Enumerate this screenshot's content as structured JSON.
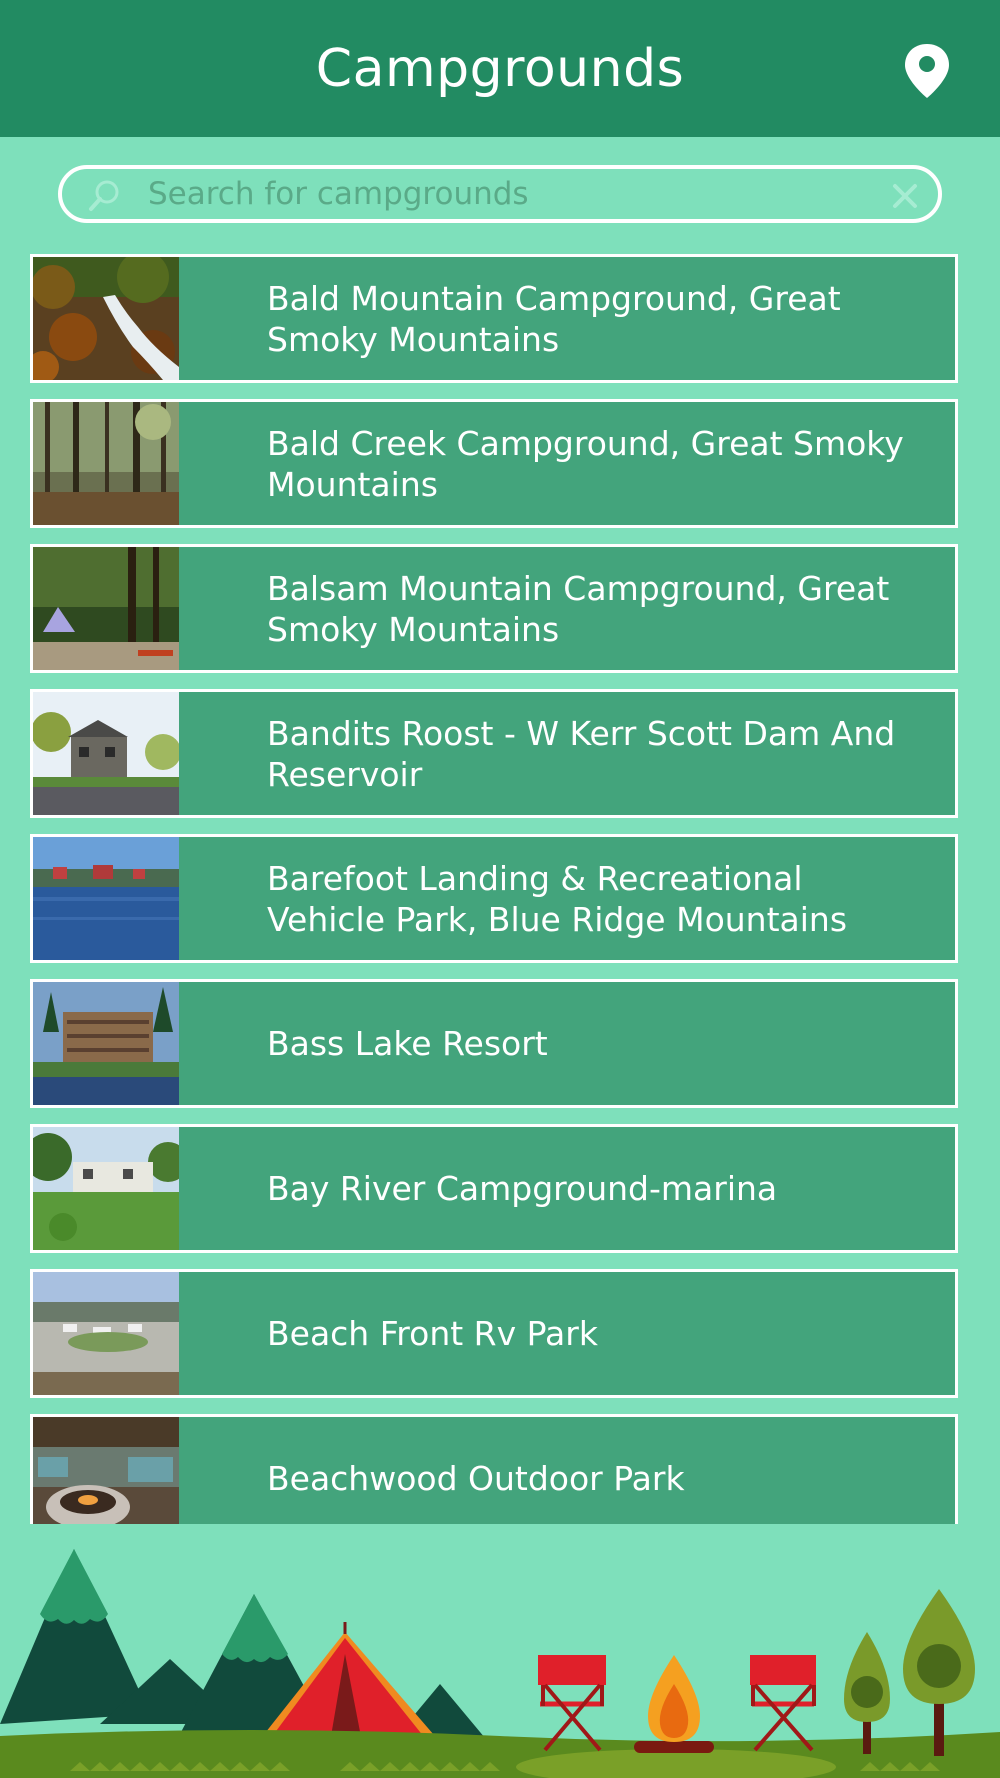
{
  "header": {
    "title": "Campgrounds",
    "map_icon": "map-pin-icon"
  },
  "search": {
    "placeholder": "Search for campgrounds",
    "value": "",
    "search_icon": "magnifier-icon",
    "clear_icon": "close-icon"
  },
  "colors": {
    "header_bg": "#228b62",
    "page_bg": "#7ee0bb",
    "item_bg": "#43a47c",
    "text": "#ffffff"
  },
  "campgrounds": [
    {
      "name": "Bald Mountain Campground, Great Smoky Mountains",
      "thumbnail": "creek-forest-photo"
    },
    {
      "name": "Bald Creek Campground, Great Smoky Mountains",
      "thumbnail": "forest-photo"
    },
    {
      "name": "Balsam Mountain Campground, Great Smoky Mountains",
      "thumbnail": "tent-forest-photo"
    },
    {
      "name": "Bandits Roost - W Kerr Scott Dam And Reservoir",
      "thumbnail": "building-photo"
    },
    {
      "name": "Barefoot Landing & Recreational Vehicle Park, Blue Ridge Mountains",
      "thumbnail": "lake-photo"
    },
    {
      "name": "Bass Lake Resort",
      "thumbnail": "resort-lake-photo"
    },
    {
      "name": "Bay River Campground-marina",
      "thumbnail": "house-lawn-photo"
    },
    {
      "name": "Beach Front Rv Park",
      "thumbnail": "rv-park-photo"
    },
    {
      "name": "Beachwood Outdoor Park",
      "thumbnail": "fire-pit-photo"
    }
  ]
}
